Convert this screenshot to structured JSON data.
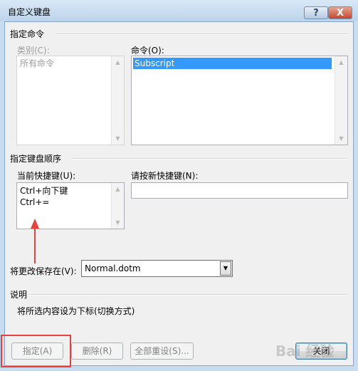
{
  "window": {
    "title": "自定义键盘",
    "help_label": "?",
    "close_label": "X"
  },
  "specify_command": {
    "section_label": "指定命令",
    "categories_label": "类别(C):",
    "categories_items": [
      "所有命令"
    ],
    "commands_label": "命令(O):",
    "commands_items": [
      "Subscript"
    ]
  },
  "keyboard_sequence": {
    "section_label": "指定键盘顺序",
    "current_keys_label": "当前快捷键(U):",
    "current_keys": [
      "Ctrl+向下键",
      "Ctrl+="
    ],
    "new_key_label": "请按新快捷键(N):",
    "new_key_value": ""
  },
  "save_in": {
    "label": "将更改保存在(V):",
    "value": "Normal.dotm"
  },
  "description": {
    "section_label": "说明",
    "text": "将所选内容设为下标(切换方式)"
  },
  "buttons": {
    "assign": "指定(A)",
    "remove": "删除(R)",
    "reset_all": "全部重设(S)...",
    "close": "关闭"
  },
  "watermark": "Bai 经验"
}
